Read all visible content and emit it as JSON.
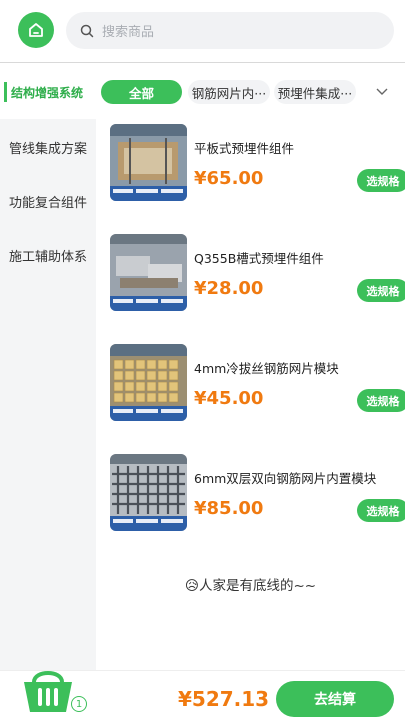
{
  "header": {
    "home_icon": "home-icon",
    "search_icon": "search-icon",
    "search_placeholder": "搜索商品"
  },
  "categories": {
    "active_main": "结构增强系统",
    "chips": [
      "全部",
      "钢筋网片内···",
      "预埋件集成···"
    ],
    "expand_icon": "chevron-down-icon"
  },
  "sidebar": {
    "items": [
      "管线集成方案",
      "功能复合组件",
      "施工辅助体系"
    ]
  },
  "products": [
    {
      "name": "平板式预埋件组件",
      "price": "¥65.00",
      "spec_label": "选规格"
    },
    {
      "name": "Q355B槽式预埋件组件",
      "price": "¥28.00",
      "spec_label": "选规格"
    },
    {
      "name": "4mm冷拔丝钢筋网片模块",
      "price": "¥45.00",
      "spec_label": "选规格"
    },
    {
      "name": "6mm双层双向钢筋网片内置模块",
      "price": "¥85.00",
      "spec_label": "选规格"
    }
  ],
  "list_end_text": "😥人家是有底线的~~",
  "cart": {
    "icon": "basket-icon",
    "count": "1",
    "total": "¥527.13",
    "checkout_label": "去结算"
  },
  "colors": {
    "accent": "#3cbf5a",
    "price": "#f07a10"
  }
}
